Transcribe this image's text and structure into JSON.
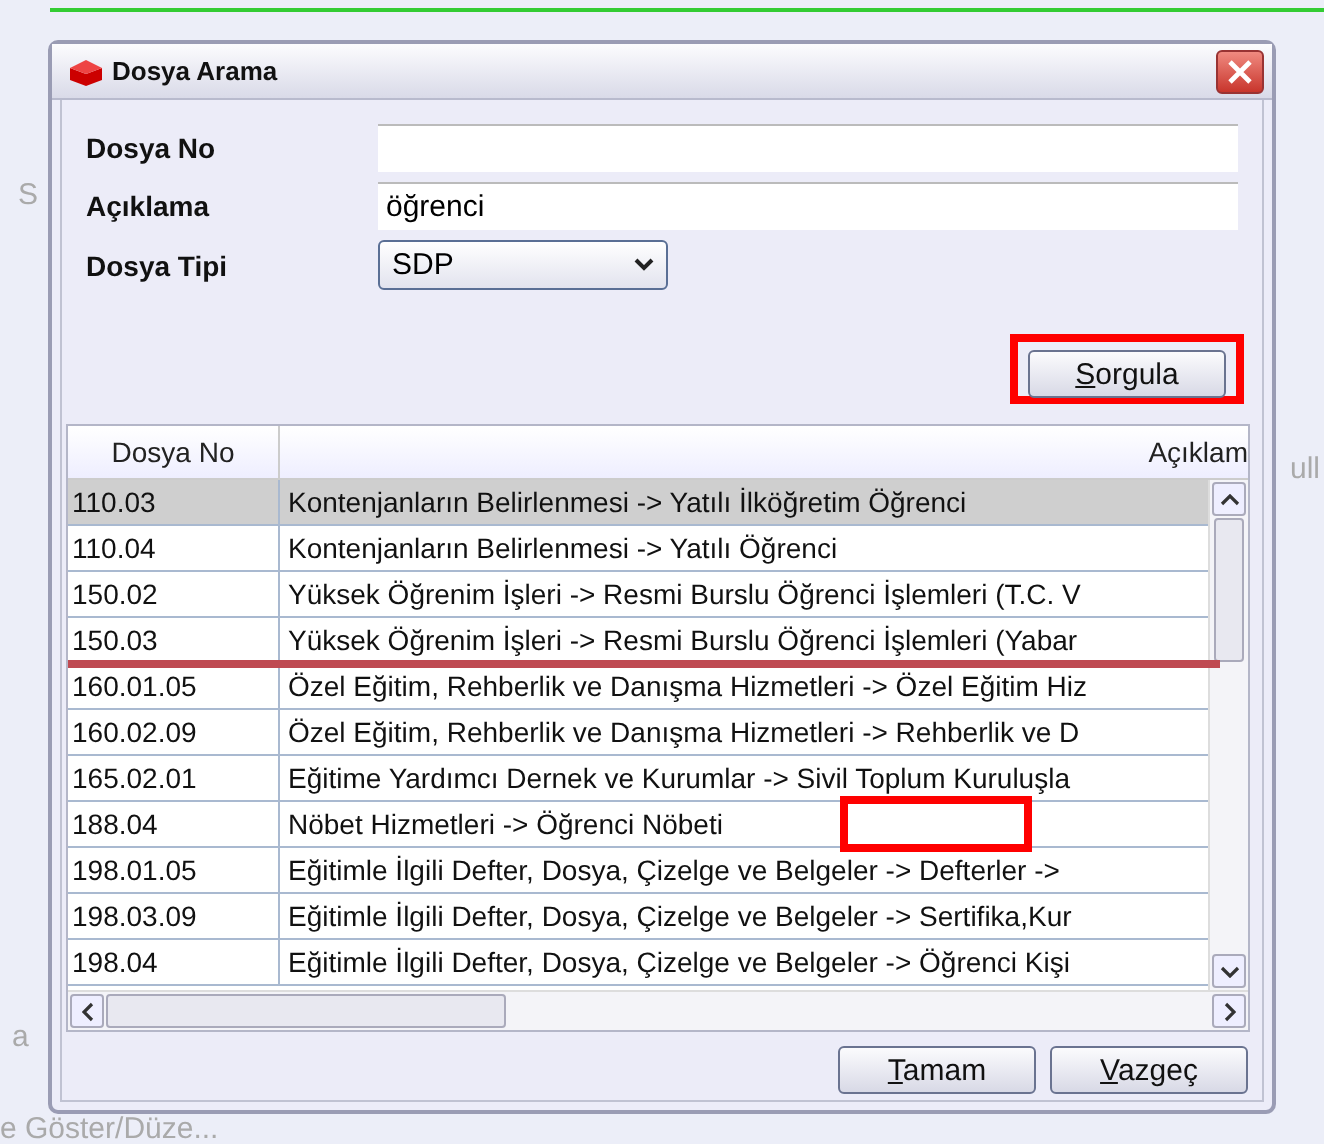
{
  "background": {
    "texts": [
      "S",
      "ull",
      "a",
      "e Göster/Düze..."
    ]
  },
  "window": {
    "title": "Dosya Arama"
  },
  "form": [
    {
      "kind": "input",
      "label": "Dosya No"
    },
    {
      "kind": "input",
      "label": "Açıklama",
      "value": "öğrenci"
    },
    {
      "kind": "select",
      "label": "Dosya Tipi",
      "value": "SDP"
    }
  ],
  "search_button": {
    "label": "Sorgula",
    "highlighted": true
  },
  "table": {
    "columns": [
      "Dosya No",
      "Açıklam"
    ],
    "rows": [
      {
        "cells": [
          "110.03",
          "Kontenjanların Belirlenmesi -> Yatılı İlköğretim Öğrenci"
        ],
        "selected": true
      },
      {
        "cells": [
          "110.04",
          "Kontenjanların Belirlenmesi -> Yatılı Öğrenci"
        ],
        "selected": false
      },
      {
        "cells": [
          "150.02",
          "Yüksek Öğrenim İşleri -> Resmi Burslu Öğrenci İşlemleri (T.C. V"
        ],
        "selected": false
      },
      {
        "cells": [
          "150.03",
          "Yüksek Öğrenim İşleri -> Resmi Burslu Öğrenci İşlemleri (Yabar"
        ],
        "selected": false
      },
      {
        "cells": [
          "160.01.05",
          "Özel Eğitim, Rehberlik ve Danışma Hizmetleri -> Özel Eğitim Hiz"
        ],
        "selected": false
      },
      {
        "cells": [
          "160.02.09",
          "Özel Eğitim, Rehberlik ve Danışma Hizmetleri -> Rehberlik ve D"
        ],
        "selected": false
      },
      {
        "cells": [
          "165.02.01",
          "Eğitime Yardımcı Dernek ve Kurumlar -> Sivil Toplum Kuruluşla"
        ],
        "selected": false
      },
      {
        "cells": [
          "188.04",
          "Nöbet Hizmetleri -> Öğrenci Nöbeti"
        ],
        "selected": false
      },
      {
        "cells": [
          "198.01.05",
          "Eğitimle İlgili Defter, Dosya, Çizelge ve Belgeler -> Defterler ->"
        ],
        "selected": false
      },
      {
        "cells": [
          "198.03.09",
          "Eğitimle İlgili Defter, Dosya, Çizelge ve Belgeler -> Sertifika,Kur"
        ],
        "selected": false
      },
      {
        "cells": [
          "198.04",
          "Eğitimle İlgili Defter, Dosya, Çizelge ve Belgeler -> Öğrenci Kişi"
        ],
        "selected": false
      }
    ]
  },
  "buttons": [
    "Tamam",
    "Vazgeç"
  ]
}
